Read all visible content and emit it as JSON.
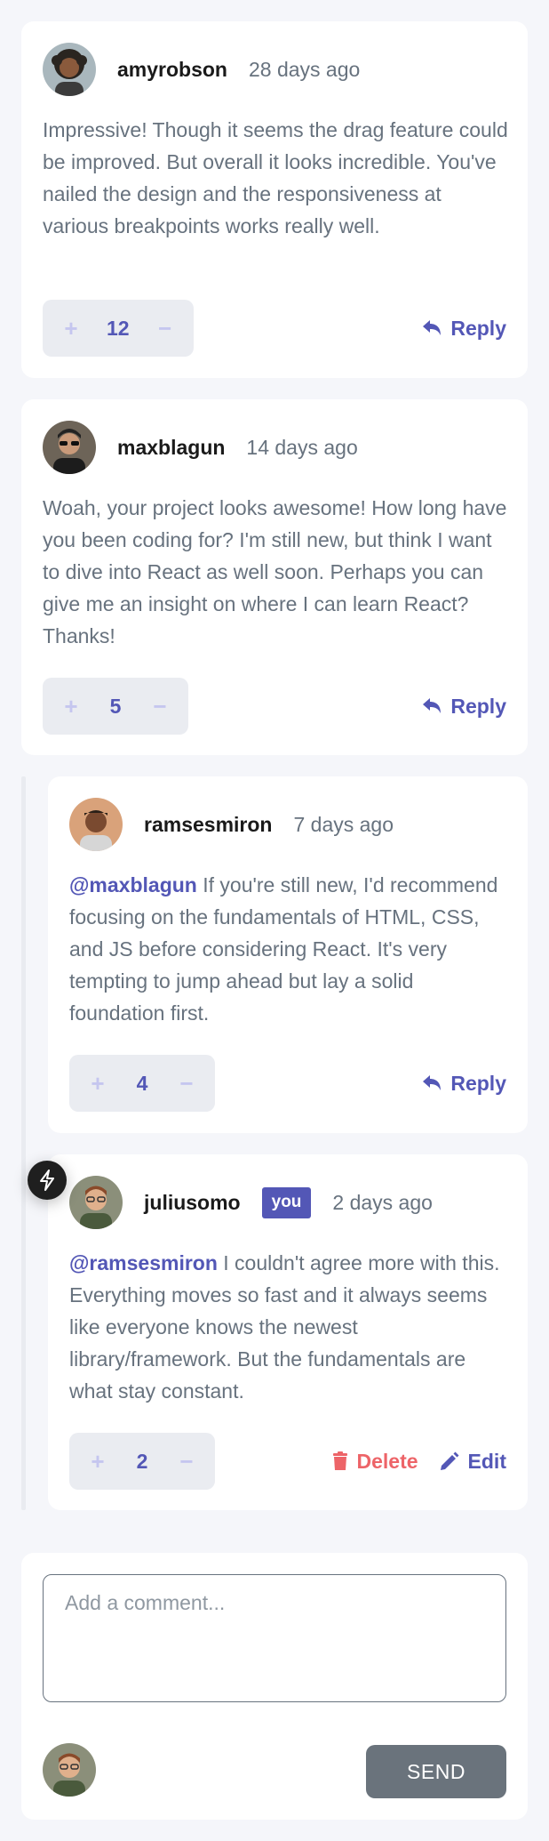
{
  "comments": [
    {
      "username": "amyrobson",
      "time": "28 days ago",
      "mention": "",
      "text": " Impressive! Though it seems the drag feature could be improved. But overall it looks incredible. You've nailed the design and the responsiveness at various breakpoints works really well.",
      "score": "12",
      "reply_label": "Reply"
    },
    {
      "username": "maxblagun",
      "time": "14 days ago",
      "mention": "",
      "text": " Woah, your project looks awesome! How long have you been coding for? I'm still new, but think I want to dive into React as well soon. Perhaps you can give me an insight on where I can learn React? Thanks!",
      "score": "5",
      "reply_label": "Reply"
    },
    {
      "username": "ramsesmiron",
      "time": "7 days ago",
      "mention": "@maxblagun",
      "text": " If you're still new, I'd recommend focusing on the fundamentals of HTML, CSS, and JS before considering React. It's very tempting to jump ahead but lay a solid foundation first.",
      "score": "4",
      "reply_label": "Reply"
    },
    {
      "username": "juliusomo",
      "badge": "you",
      "time": "2 days ago",
      "mention": "@ramsesmiron",
      "text": " I couldn't agree more with this. Everything moves so fast and it always seems like everyone knows the newest library/framework. But the fundamentals are what stay constant.",
      "score": "2",
      "delete_label": "Delete",
      "edit_label": "Edit"
    }
  ],
  "vote": {
    "plus": "+",
    "minus": "−"
  },
  "compose": {
    "placeholder": "Add a comment...",
    "send_label": "SEND"
  },
  "icons": {
    "reply": "reply-icon",
    "delete": "trash-icon",
    "edit": "pencil-icon",
    "fab": "lightning-icon"
  },
  "colors": {
    "background": "#f5f6fa",
    "card": "#ffffff",
    "accent": "#5357b6",
    "accent_light": "#c5c6ef",
    "danger": "#ed6468",
    "text": "#67727e",
    "username": "#1a1a1a",
    "vote_bg": "#eaecf1",
    "send_button": "#6a737c"
  }
}
